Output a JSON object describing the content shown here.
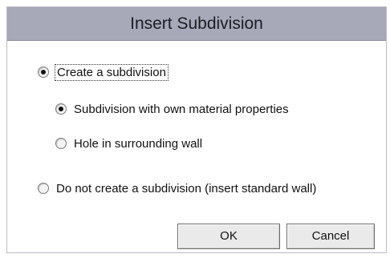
{
  "dialog": {
    "title": "Insert Subdivision"
  },
  "options": {
    "create_subdivision": {
      "label": "Create a subdivision",
      "checked": true
    },
    "own_material": {
      "label": "Subdivision with own material properties",
      "checked": true
    },
    "hole_in_wall": {
      "label": "Hole in surrounding wall",
      "checked": false
    },
    "no_subdivision": {
      "label": "Do not create a subdivision (insert standard wall)",
      "checked": false
    }
  },
  "buttons": {
    "ok_label": "OK",
    "cancel_label": "Cancel"
  }
}
